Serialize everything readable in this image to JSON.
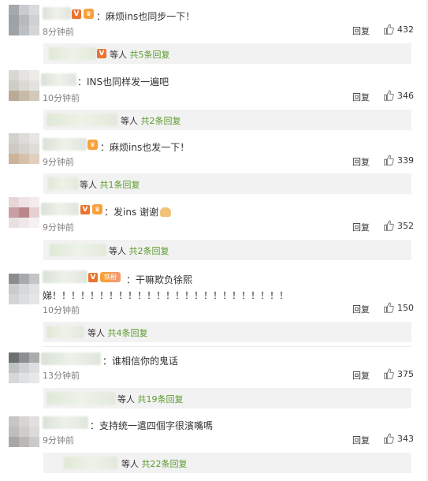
{
  "comments": [
    {
      "content": "：麻烦ins也同步一下！",
      "time": "8分钟前",
      "reply": "回复",
      "likes": "432",
      "sub_users": "等人",
      "sub_count": "共5条回复"
    },
    {
      "content": "：INS也同样发一遍吧",
      "time": "10分钟前",
      "reply": "回复",
      "likes": "346",
      "sub_users": "等人",
      "sub_count": "共2条回复"
    },
    {
      "content": "：麻烦ins也发一下！",
      "time": "9分钟前",
      "reply": "回复",
      "likes": "339",
      "sub_users": "等人",
      "sub_count": "共1条回复"
    },
    {
      "content": "：发ins 谢谢",
      "time": "9分钟前",
      "reply": "回复",
      "likes": "352",
      "sub_users": "等人",
      "sub_count": "共2条回复"
    },
    {
      "content": "：干嘛欺负徐熙",
      "content_line2": "娣！！！！！！！！！！！！！！！！！！！！！！！！！",
      "time": "10分钟前",
      "reply": "回复",
      "likes": "150",
      "sub_users": "等人",
      "sub_count": "共4条回复"
    },
    {
      "content": "：谁相信你的鬼话",
      "time": "13分钟前",
      "reply": "回复",
      "likes": "375",
      "sub_users": "等人",
      "sub_count": "共19条回复"
    },
    {
      "content": "：支持统一遣四個字很濱嘴嗎",
      "time": "9分钟前",
      "reply": "回复",
      "likes": "343",
      "sub_users": "等人",
      "sub_count": "共22条回复"
    }
  ],
  "badges": {
    "v": "V",
    "fan_label": "铁粉"
  },
  "colors": {
    "accent_green": "#5a9a2c",
    "v_badge": "#e8742f",
    "fan_badge": "#f7a13b"
  }
}
